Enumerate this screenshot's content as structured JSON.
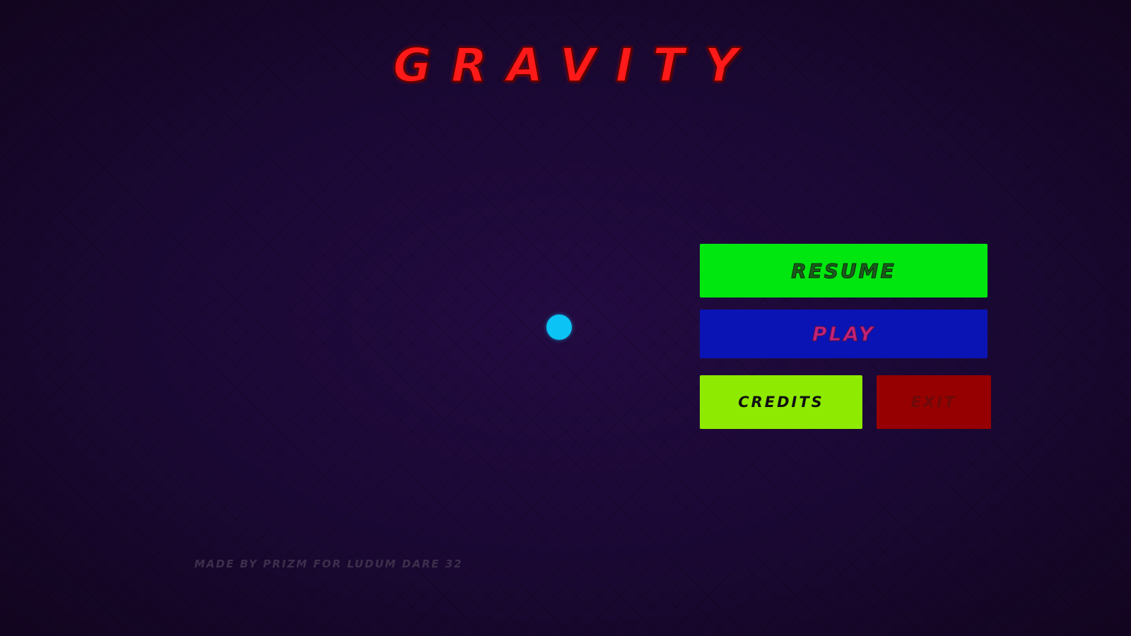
{
  "game": {
    "title": "GRAVITY",
    "footer_credit": "MADE BY PRIZM FOR LUDUM DARE 32"
  },
  "menu": {
    "resume_label": "RESUME",
    "play_label": "PLAY",
    "credits_label": "CREDITS",
    "exit_label": "EXIT"
  },
  "colors": {
    "background": "#1a0833",
    "title": "#ff1a1a",
    "ball": "#0cc3f5",
    "resume_button": "#00e60f",
    "play_button": "#0a14b4",
    "credits_button": "#8eea00",
    "exit_button": "#960000"
  }
}
